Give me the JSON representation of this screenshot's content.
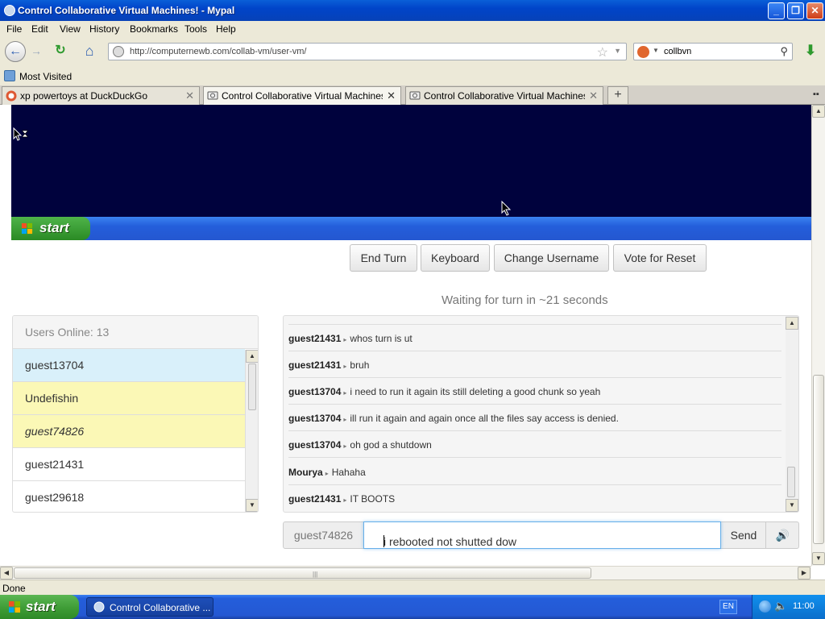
{
  "window": {
    "title": "Control Collaborative Virtual Machines! - Mypal",
    "controls": {
      "minimize": "_",
      "maximize": "❐",
      "close": "✕"
    }
  },
  "menu": {
    "items": [
      "File",
      "Edit",
      "View",
      "History",
      "Bookmarks",
      "Tools",
      "Help"
    ]
  },
  "nav": {
    "back": "←",
    "forward": "→",
    "reload": "↻",
    "home": "⌂",
    "url": "http://computernewb.com/collab-vm/user-vm/",
    "search_value": "collbvn",
    "download": "⬇"
  },
  "bookmarks": {
    "most_visited": "Most Visited"
  },
  "tabs": [
    {
      "label": "xp powertoys at DuckDuckGo"
    },
    {
      "label": "Control Collaborative Virtual Machines!"
    },
    {
      "label": "Control Collaborative Virtual Machines!"
    }
  ],
  "tab_controls": {
    "close": "✕",
    "new_tab": "+",
    "list": "▪▪"
  },
  "vm": {
    "start_label": "start"
  },
  "controls": {
    "end_turn": "End Turn",
    "keyboard": "Keyboard",
    "change_username": "Change Username",
    "vote_reset": "Vote for Reset"
  },
  "waiting": "Waiting for turn in ~21 seconds",
  "users": {
    "header": "Users Online: 13",
    "list": [
      {
        "name": "guest13704"
      },
      {
        "name": "Undefishin"
      },
      {
        "name": "guest74826"
      },
      {
        "name": "guest21431"
      },
      {
        "name": "guest29618"
      }
    ]
  },
  "chat": {
    "messages": [
      {
        "user": "guest21431",
        "text": "whos turn is ut"
      },
      {
        "user": "guest21431",
        "text": "bruh"
      },
      {
        "user": "guest13704",
        "text": "i need to run it again its still deleting a good chunk so yeah"
      },
      {
        "user": "guest13704",
        "text": "ill run it again and again once all the files say access is denied."
      },
      {
        "user": "guest13704",
        "text": "oh god a shutdown"
      },
      {
        "user": "Mourya",
        "text": "Hahaha"
      },
      {
        "user": "guest21431",
        "text": "IT BOOTS"
      }
    ],
    "arrow": "▸",
    "username": "guest74826",
    "input_value": "i rebooted not shutted dow",
    "send": "Send",
    "sound_icon": "🔊"
  },
  "status": "Done",
  "taskbar": {
    "start_label": "start",
    "task_label": "Control Collaborative ...",
    "lang": "EN",
    "clock": "11:00"
  },
  "colors": {
    "vm_background": "#00023d",
    "user_highlight_blue": "#d9f0fa",
    "user_highlight_yellow": "#fbf8b6",
    "xp_blue": "#245edb",
    "xp_green": "#3c9a34"
  }
}
